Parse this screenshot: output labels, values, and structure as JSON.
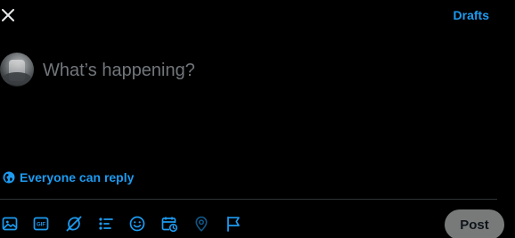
{
  "header": {
    "close_icon": "close-icon",
    "drafts_label": "Drafts"
  },
  "composer": {
    "placeholder": "What’s happening?",
    "value": ""
  },
  "reply_setting": {
    "icon": "globe-icon",
    "label": "Everyone can reply"
  },
  "toolbar": {
    "items": [
      {
        "name": "media",
        "icon": "image-icon"
      },
      {
        "name": "gif",
        "icon": "gif-icon"
      },
      {
        "name": "grok",
        "icon": "grok-icon"
      },
      {
        "name": "poll",
        "icon": "poll-icon"
      },
      {
        "name": "emoji",
        "icon": "emoji-icon"
      },
      {
        "name": "schedule",
        "icon": "schedule-icon"
      },
      {
        "name": "location",
        "icon": "location-icon"
      },
      {
        "name": "flag",
        "icon": "flag-icon"
      }
    ],
    "post_label": "Post"
  },
  "colors": {
    "background": "#000000",
    "accent": "#1d9bf0",
    "placeholder": "#71767b",
    "divider": "#2f3336",
    "post_button_disabled": "#787a7a"
  }
}
